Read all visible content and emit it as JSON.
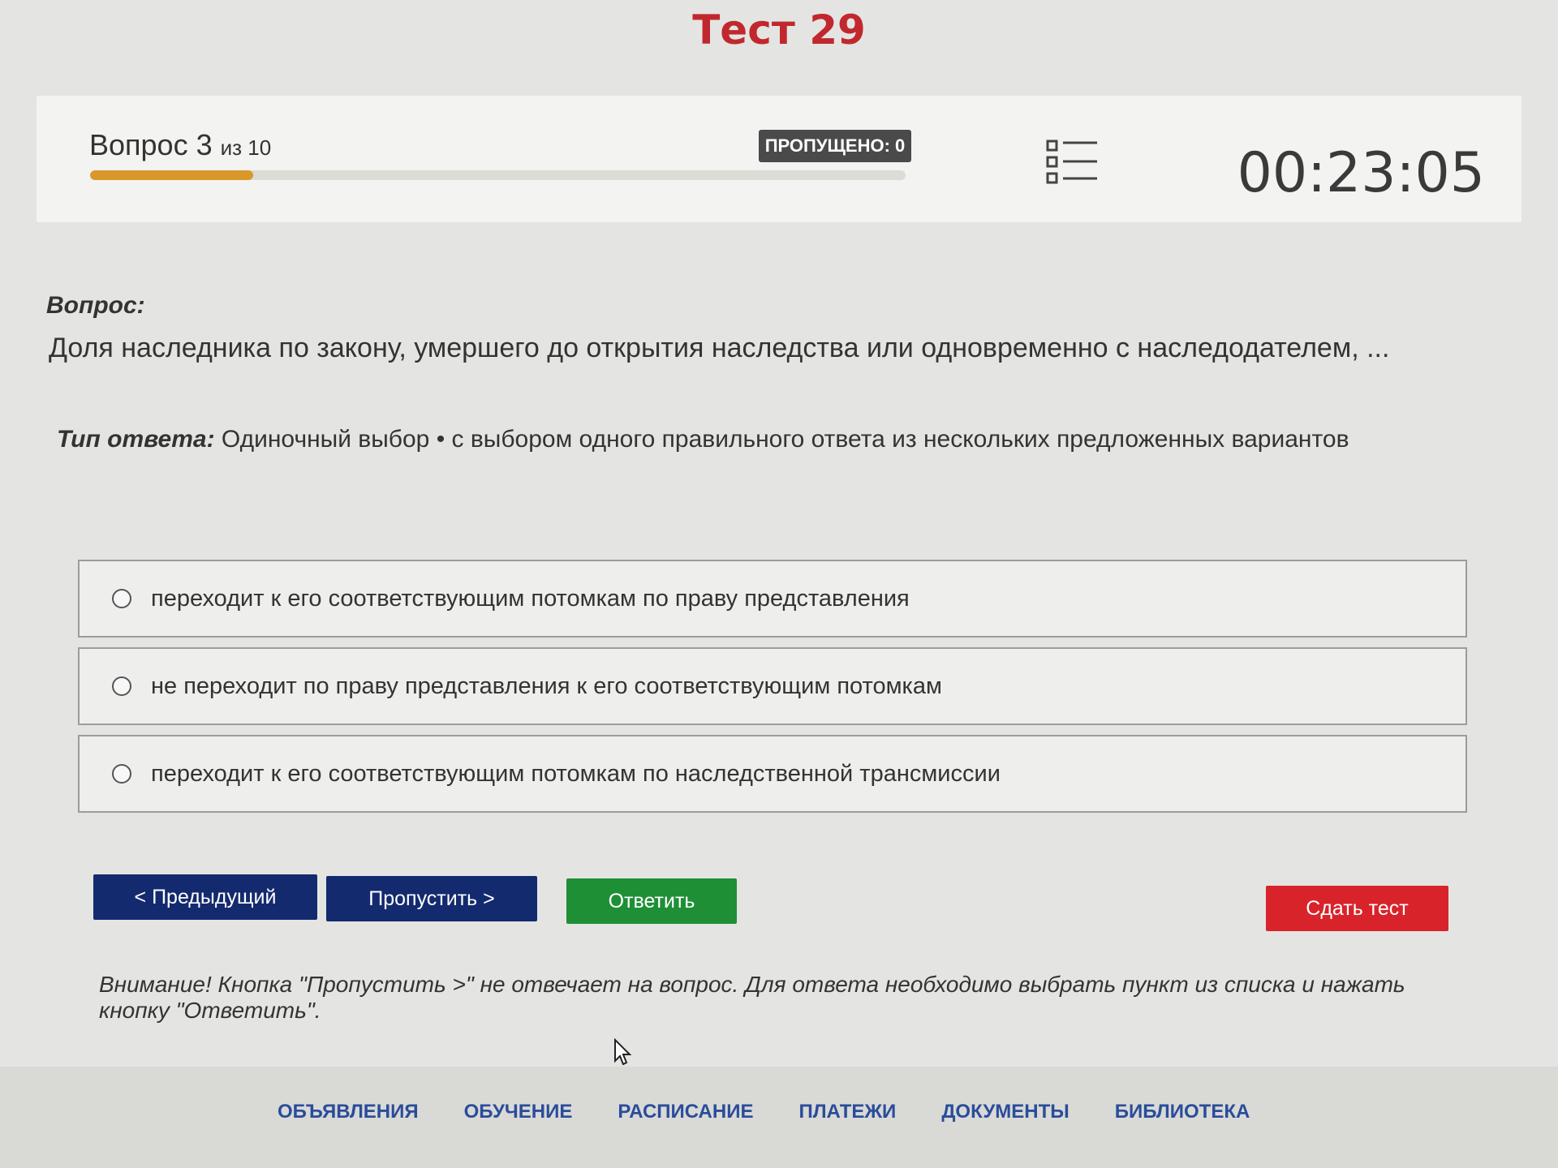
{
  "page": {
    "title": "Тест 29"
  },
  "status": {
    "question_label": "Вопрос 3",
    "of_label": "из 10",
    "progress": 0.2,
    "skipped_label": "ПРОПУЩЕНО: 0",
    "list_icon": "question-list-icon",
    "timer": "00:23:05"
  },
  "question": {
    "label": "Вопрос:",
    "text": "Доля наследника по закону, умершего до открытия наследства или одновременно с наследодателем, ..."
  },
  "answer_type": {
    "label": "Тип ответа:",
    "value": "Одиночный выбор • с выбором одного правильного ответа из нескольких предложенных вариантов"
  },
  "options": [
    {
      "label": "переходит к его соответствующим потомкам по праву представления",
      "selected": false
    },
    {
      "label": "не переходит по праву представления к его соответствующим потомкам",
      "selected": false
    },
    {
      "label": "переходит к его соответствующим потомкам по наследственной трансмиссии",
      "selected": false
    }
  ],
  "buttons": {
    "prev": "< Предыдущий",
    "skip": "Пропустить >",
    "answer": "Ответить",
    "submit": "Сдать тест"
  },
  "warning": "Внимание! Кнопка \"Пропустить >\" не отвечает на вопрос. Для ответа необходимо выбрать пункт из списка и нажать кнопку \"Ответить\".",
  "footer": {
    "nav": [
      "ОБЪЯВЛЕНИЯ",
      "ОБУЧЕНИЕ",
      "РАСПИСАНИЕ",
      "ПЛАТЕЖИ",
      "ДОКУМЕНТЫ",
      "БИБЛИОТЕКА"
    ]
  },
  "colors": {
    "title": "#c0282d",
    "progress": "#d9982a",
    "nav_button": "#142a6e",
    "answer_button": "#1f8f36",
    "submit_button": "#d9232b",
    "footer_link": "#2a4d9a"
  }
}
